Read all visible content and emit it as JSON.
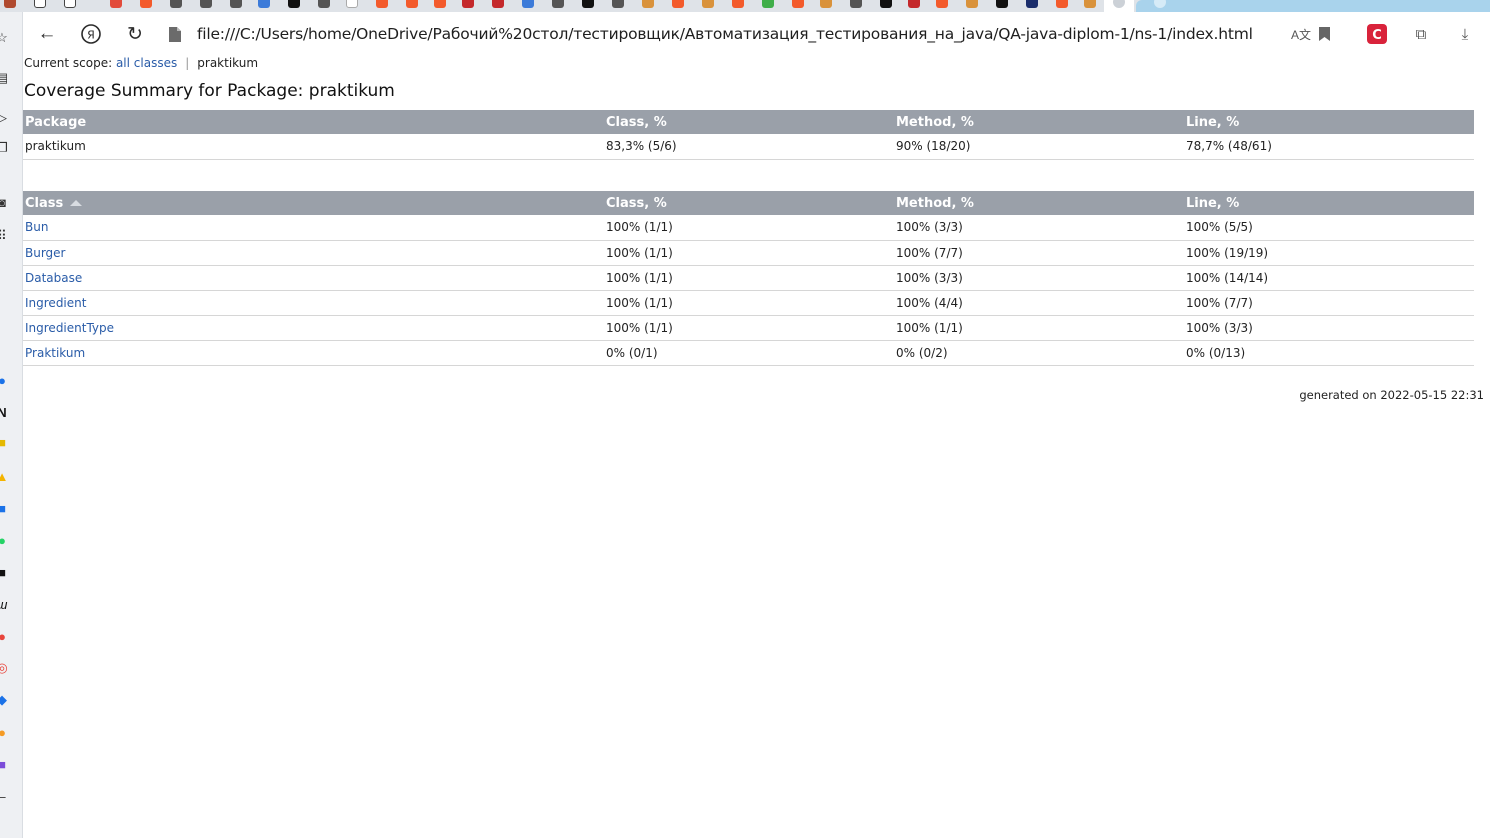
{
  "browser": {
    "url": "file:///C:/Users/home/OneDrive/Рабочий%20стол/тестировщик/Автоматизация_тестирования_на_java/QA-java-diplom-1/ns-1/index.html",
    "accent_color": "#a9d3ec"
  },
  "scope": {
    "prefix": "Current scope:",
    "all_classes_link": "all classes",
    "current": "praktikum"
  },
  "page_title": "Coverage Summary for Package: praktikum",
  "package_table": {
    "headers": [
      "Package",
      "Class, %",
      "Method, %",
      "Line, %"
    ],
    "rows": [
      [
        "praktikum",
        "83,3% (5/6)",
        "90% (18/20)",
        "78,7% (48/61)"
      ]
    ]
  },
  "class_table": {
    "headers": [
      "Class",
      "Class, %",
      "Method, %",
      "Line, %"
    ],
    "rows": [
      [
        "Bun",
        "100% (1/1)",
        "100% (3/3)",
        "100% (5/5)"
      ],
      [
        "Burger",
        "100% (1/1)",
        "100% (7/7)",
        "100% (19/19)"
      ],
      [
        "Database",
        "100% (1/1)",
        "100% (3/3)",
        "100% (14/14)"
      ],
      [
        "Ingredient",
        "100% (1/1)",
        "100% (4/4)",
        "100% (7/7)"
      ],
      [
        "IngredientType",
        "100% (1/1)",
        "100% (1/1)",
        "100% (3/3)"
      ],
      [
        "Praktikum",
        "0% (0/1)",
        "0% (0/2)",
        "0% (0/13)"
      ]
    ]
  },
  "footer": {
    "generated": "generated on 2022-05-15 22:31"
  },
  "icons": {
    "back": "back-arrow-icon",
    "yandex": "yandex-logo-icon",
    "reload": "reload-icon",
    "file": "file-icon",
    "translate": "translate-icon",
    "bookmark": "bookmark-icon",
    "extension": "extension-icon",
    "collections": "collections-icon",
    "download": "download-icon"
  }
}
